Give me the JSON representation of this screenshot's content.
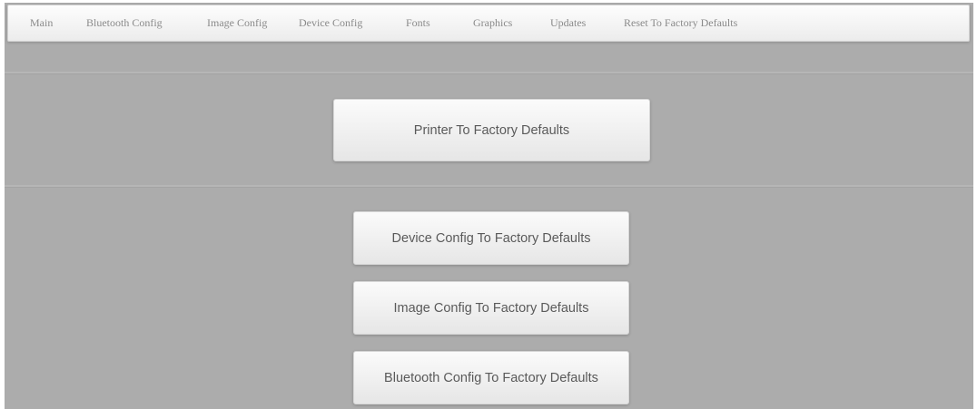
{
  "nav": {
    "items": [
      {
        "label": "Main"
      },
      {
        "label": "Bluetooth Config"
      },
      {
        "label": "Image Config"
      },
      {
        "label": "Device Config"
      },
      {
        "label": "Fonts"
      },
      {
        "label": "Graphics"
      },
      {
        "label": "Updates"
      },
      {
        "label": "Reset To Factory Defaults"
      }
    ]
  },
  "actions": {
    "printer_label": "Printer To Factory Defaults",
    "device_label": "Device Config To Factory Defaults",
    "image_label": "Image Config To Factory Defaults",
    "bluetooth_label": "Bluetooth Config To Factory Defaults"
  }
}
